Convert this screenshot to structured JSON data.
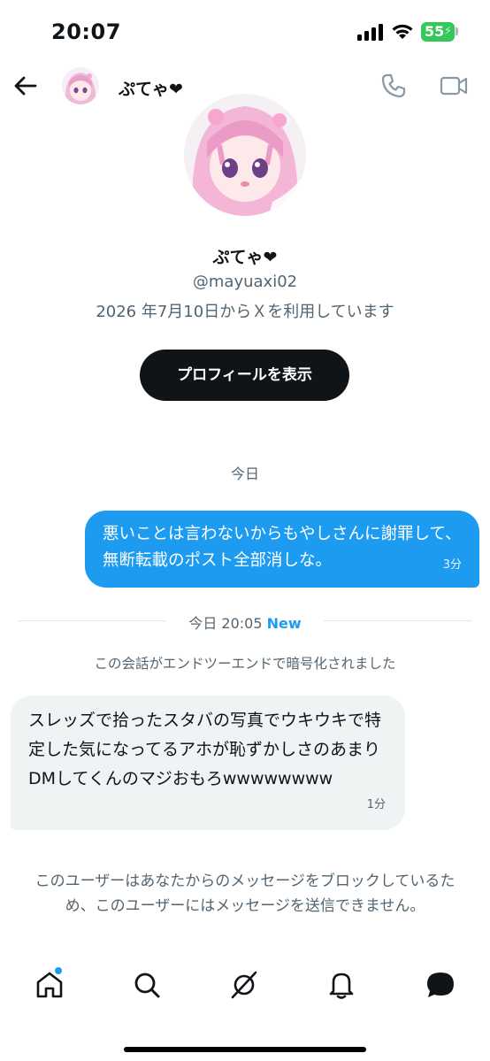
{
  "status_bar": {
    "time": "20:07",
    "battery": "55",
    "battery_color": "#34c759"
  },
  "header": {
    "name": "ぷてゃ❤",
    "back_icon": "back-arrow-icon",
    "call_icon": "phone-icon",
    "video_icon": "video-camera-icon"
  },
  "profile": {
    "name": "ぷてゃ❤",
    "handle": "@mayuaxi02",
    "joined": "2026 年7月10日からＸを利用しています",
    "view_profile_label": "プロフィールを表示"
  },
  "conversation": {
    "date_separator": "今日",
    "outgoing": {
      "text": "悪いことは言わないからもやしさんに謝罪して、無断転載のポスト全部消しな。",
      "time": "3分"
    },
    "new_separator": {
      "label": "今日 20:05",
      "new_label": "New"
    },
    "encryption_note": "この会話がエンドツーエンドで暗号化されました",
    "incoming": {
      "text": "スレッズで拾ったスタバの写真でウキウキで特定した気になってるアホが恥ずかしさのあまりDMしてくんのマジおもろwwwwwwww",
      "time": "1分"
    },
    "blocked_note": "このユーザーはあなたからのメッセージをブロックしているため、このユーザーにはメッセージを送信できません。"
  },
  "tab_bar": {
    "items": [
      {
        "icon": "home-icon",
        "has_notification_dot": true
      },
      {
        "icon": "search-icon"
      },
      {
        "icon": "grok-icon"
      },
      {
        "icon": "bell-icon"
      },
      {
        "icon": "messages-icon",
        "active": true
      }
    ]
  },
  "colors": {
    "accent": "#1d9bf0",
    "text_primary": "#0f1419",
    "text_secondary": "#536471",
    "incoming_bubble": "#eff3f4"
  }
}
